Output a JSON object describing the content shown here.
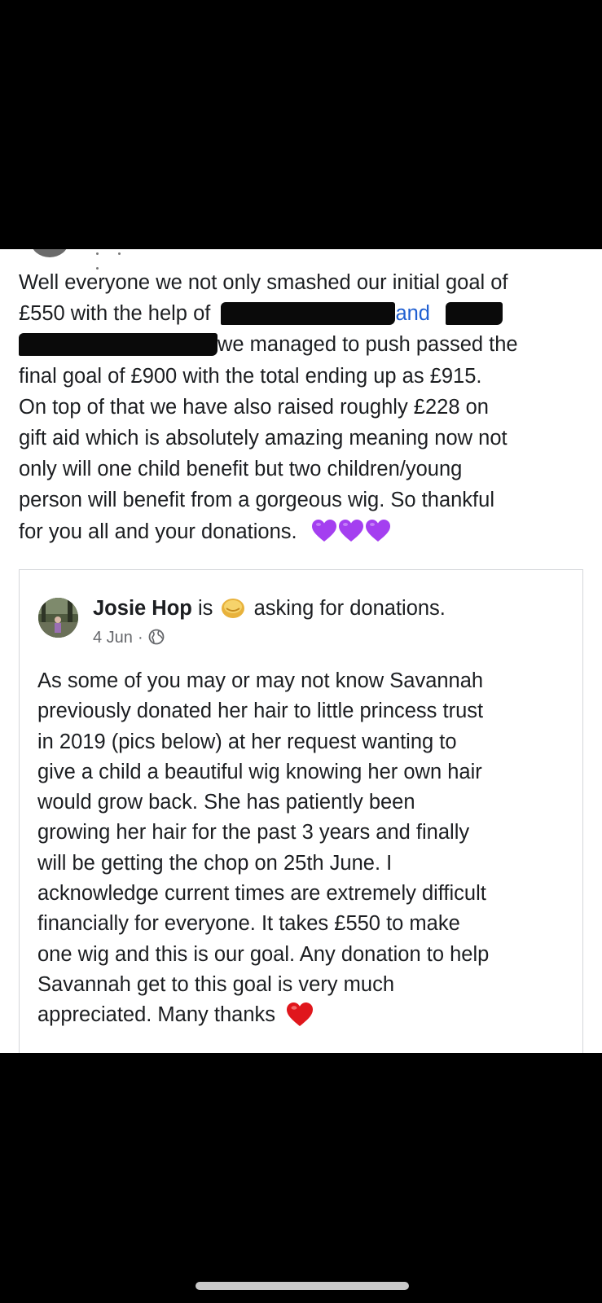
{
  "post": {
    "line1": "Well everyone we not only smashed our initial goal of",
    "line2_a": "£550 with the help of",
    "line2_and": "and",
    "line3_b": "we managed to push passed the",
    "line4": "final goal of £900 with the total ending up as £915.",
    "line5": "On top of that we have also raised roughly £228 on",
    "line6": "gift aid which is absolutely amazing meaning now not",
    "line7": "only will one child benefit but two children/young",
    "line8": "person will benefit from a gorgeous wig.  So thankful",
    "line9": "for you all and your donations.",
    "heart_color": "#a43ff0"
  },
  "shared_post": {
    "author": "Josie Hop",
    "verb": "is",
    "activity": "asking for donations.",
    "date": "4 Jun",
    "separator": "·",
    "privacy_icon": "globe-icon",
    "activity_icon": "coin-emoji-icon",
    "lines": [
      "As some of you may or may not know Savannah",
      "previously donated her hair to little princess trust",
      "in 2019 (pics below) at her request wanting to",
      "give a child a beautiful wig knowing her own hair",
      "would grow back.  She has patiently been",
      "growing her hair for the past 3 years and finally",
      "will be getting the chop on 25th June. I",
      "acknowledge current times are extremely difficult",
      "financially for everyone.  It takes £550 to make",
      "one wig and this is our goal.  Any donation to help",
      "Savannah get to this goal is very much",
      "appreciated. Many thanks"
    ],
    "heart_color": "#e0161c"
  },
  "colors": {
    "link": "#1f5fd1",
    "text": "#1c1e21",
    "meta": "#65676b"
  }
}
